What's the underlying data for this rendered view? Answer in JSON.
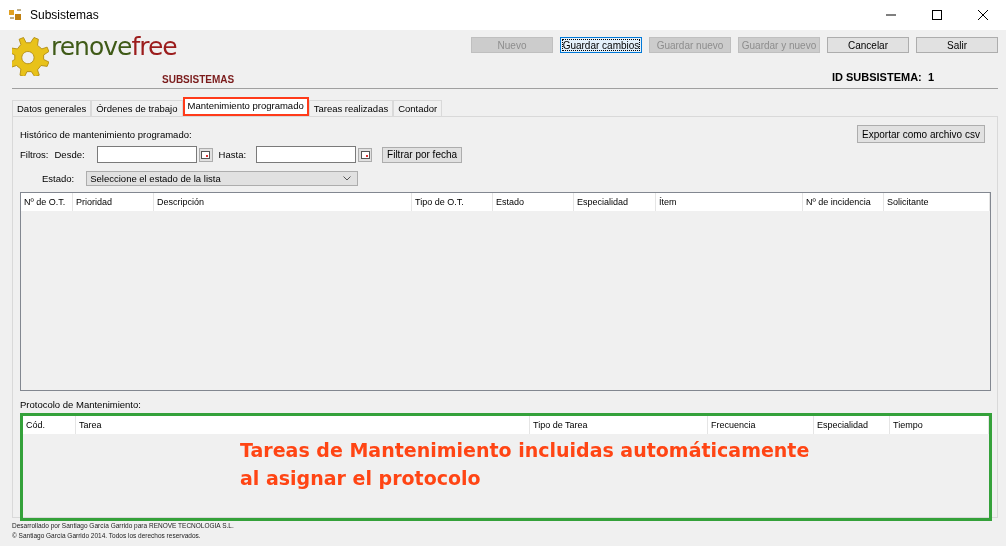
{
  "window": {
    "title": "Subsistemas"
  },
  "logo": {
    "part_1": "renove",
    "part_2": "free"
  },
  "toolbar": [
    {
      "label": "Nuevo",
      "disabled": true,
      "focused": false
    },
    {
      "label": "Guardar cambios",
      "disabled": false,
      "focused": true
    },
    {
      "label": "Guardar nuevo",
      "disabled": true,
      "focused": false
    },
    {
      "label": "Guardar y nuevo",
      "disabled": true,
      "focused": false
    },
    {
      "label": "Cancelar",
      "disabled": false,
      "focused": false
    },
    {
      "label": "Salir",
      "disabled": false,
      "focused": false
    }
  ],
  "section_title": "SUBSISTEMAS",
  "record_id": {
    "label": "ID SUBSISTEMA:",
    "value": "1"
  },
  "tabs": [
    {
      "label": "Datos generales",
      "selected": false
    },
    {
      "label": "Órdenes de trabajo",
      "selected": false
    },
    {
      "label": "Mantenimiento programado",
      "selected": true
    },
    {
      "label": "Tareas realizadas",
      "selected": false
    },
    {
      "label": "Contador",
      "selected": false
    }
  ],
  "history": {
    "title": "Histórico de mantenimiento programado:",
    "export_button": "Exportar como archivo csv",
    "filters_label": "Filtros:",
    "from_label": "Desde:",
    "to_label": "Hasta:",
    "filter_button": "Filtrar por fecha",
    "status_label": "Estado:",
    "status_select": "Seleccione el estado de la lista",
    "columns": [
      "Nº de O.T.",
      "Prioridad",
      "Descripción",
      "Tipo de O.T.",
      "Estado",
      "Especialidad",
      "Ítem",
      "Nº de incidencia",
      "Solicitante"
    ]
  },
  "protocol": {
    "title": "Protocolo de Mantenimiento:",
    "columns": [
      "Cód.",
      "Tarea",
      "Tipo de Tarea",
      "Frecuencia",
      "Especialidad",
      "Tiempo"
    ],
    "annotation": [
      "Tareas de Mantenimiento incluidas automáticamente",
      "al asignar el protocolo"
    ]
  },
  "footer": [
    "Desarrollado por Santiago García Garrido para RENOVE TECNOLOGIA S.L.",
    "© Santiago García Garrido 2014. Todos los derechos reservados."
  ]
}
